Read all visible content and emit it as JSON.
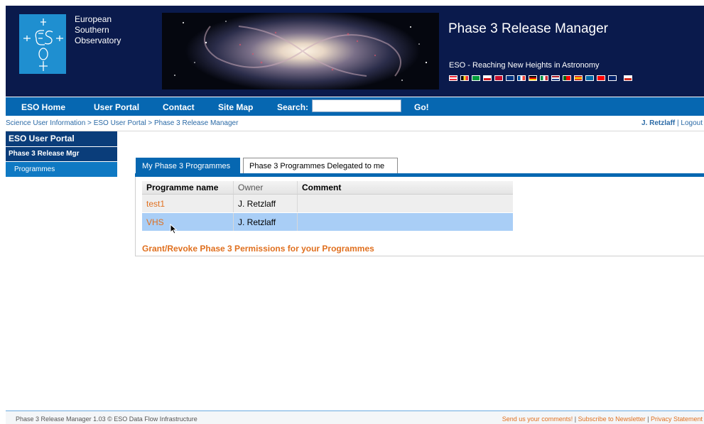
{
  "colors": {
    "header_bg": "#0a1a4c",
    "nav_bg": "#0667b1",
    "sidebar_dark": "#0a3d7a",
    "sidebar_active": "#0f79c3",
    "link_orange": "#e0701f",
    "row_selected": "#a9cef6"
  },
  "header": {
    "logo_icon": "eso-logo-icon",
    "org_lines": [
      "European",
      "Southern",
      "Observatory"
    ],
    "app_title": "Phase 3 Release Manager",
    "tagline": "ESO - Reaching New Heights in Astronomy",
    "language_flags": [
      "flag-icon",
      "flag-icon",
      "flag-icon",
      "flag-icon",
      "flag-icon",
      "flag-icon",
      "flag-icon",
      "flag-icon",
      "flag-icon",
      "flag-icon",
      "flag-icon",
      "flag-icon",
      "flag-icon",
      "flag-icon",
      "flag-icon",
      "flag-icon"
    ]
  },
  "nav": {
    "eso_home": "ESO Home",
    "user_portal": "User Portal",
    "contact": "Contact",
    "site_map": "Site Map",
    "search_label": "Search:",
    "search_value": "",
    "go": "Go!"
  },
  "breadcrumb": {
    "items": [
      "Science User Information",
      "ESO User Portal",
      "Phase 3 Release Manager"
    ],
    "separator": " > "
  },
  "user": {
    "name": "J. Retzlaff",
    "separator": " | ",
    "logout": "Logout"
  },
  "sidebar": {
    "portal": "ESO User Portal",
    "release_mgr": "Phase 3 Release Mgr",
    "programmes": "Programmes"
  },
  "tabs": {
    "mine": "My Phase 3 Programmes",
    "delegated": "Phase 3 Programmes Delegated to me"
  },
  "table": {
    "headers": [
      "Programme name",
      "Owner",
      "Comment"
    ],
    "rows": [
      {
        "name": "test1",
        "owner": "J. Retzlaff",
        "comment": ""
      },
      {
        "name": "VHS",
        "owner": "J. Retzlaff",
        "comment": ""
      }
    ]
  },
  "grant_link": "Grant/Revoke Phase 3 Permissions for your Programmes",
  "footer": {
    "left": "Phase 3 Release Manager 1.03 © ESO Data Flow Infrastructure",
    "comments": "Send us your comments!",
    "newsletter": "Subscribe to Newsletter",
    "privacy": "Privacy Statement",
    "separator": " | "
  }
}
